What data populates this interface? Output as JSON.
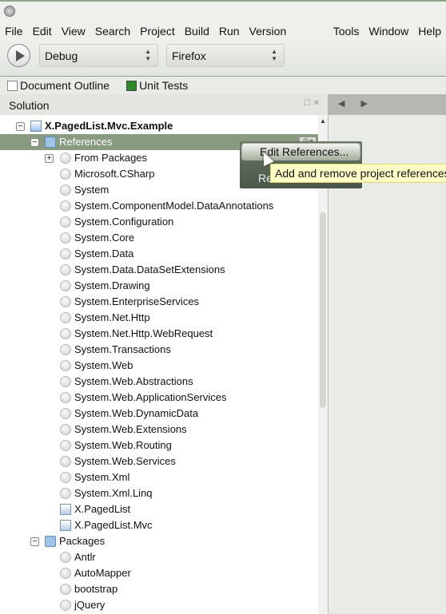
{
  "menu": [
    "File",
    "Edit",
    "View",
    "Search",
    "Project",
    "Build",
    "Run",
    "Version Control",
    "Tools",
    "Window",
    "Help"
  ],
  "toolbar": {
    "configuration": "Debug",
    "target": "Firefox"
  },
  "pads": {
    "document_outline": "Document Outline",
    "unit_tests": "Unit Tests"
  },
  "solution": {
    "title": "Solution",
    "project": "X.PagedList.Mvc.Example",
    "references_label": "References",
    "references": [
      {
        "label": "From Packages",
        "type": "folder"
      },
      {
        "label": "Microsoft.CSharp",
        "type": "ref"
      },
      {
        "label": "System",
        "type": "ref"
      },
      {
        "label": "System.ComponentModel.DataAnnotations",
        "type": "ref"
      },
      {
        "label": "System.Configuration",
        "type": "ref"
      },
      {
        "label": "System.Core",
        "type": "ref"
      },
      {
        "label": "System.Data",
        "type": "ref"
      },
      {
        "label": "System.Data.DataSetExtensions",
        "type": "ref"
      },
      {
        "label": "System.Drawing",
        "type": "ref"
      },
      {
        "label": "System.EnterpriseServices",
        "type": "ref"
      },
      {
        "label": "System.Net.Http",
        "type": "ref"
      },
      {
        "label": "System.Net.Http.WebRequest",
        "type": "ref"
      },
      {
        "label": "System.Transactions",
        "type": "ref"
      },
      {
        "label": "System.Web",
        "type": "ref"
      },
      {
        "label": "System.Web.Abstractions",
        "type": "ref"
      },
      {
        "label": "System.Web.ApplicationServices",
        "type": "ref"
      },
      {
        "label": "System.Web.DynamicData",
        "type": "ref"
      },
      {
        "label": "System.Web.Extensions",
        "type": "ref"
      },
      {
        "label": "System.Web.Routing",
        "type": "ref"
      },
      {
        "label": "System.Web.Services",
        "type": "ref"
      },
      {
        "label": "System.Xml",
        "type": "ref"
      },
      {
        "label": "System.Xml.Linq",
        "type": "ref"
      },
      {
        "label": "X.PagedList",
        "type": "project"
      },
      {
        "label": "X.PagedList.Mvc",
        "type": "project"
      }
    ],
    "packages_label": "Packages",
    "packages": [
      "Antlr",
      "AutoMapper",
      "bootstrap",
      "jQuery"
    ]
  },
  "context_menu": {
    "items": [
      "Edit References...",
      "Refresh"
    ]
  },
  "tooltip": "Add and remove project references"
}
